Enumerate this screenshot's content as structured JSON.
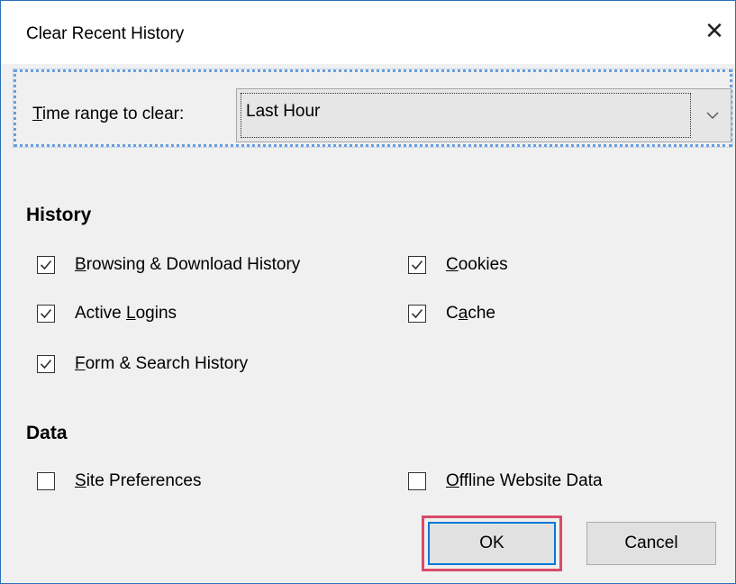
{
  "dialog": {
    "title": "Clear Recent History",
    "close_icon": "close-icon"
  },
  "time_range": {
    "label_prefix": "T",
    "label_rest": "ime range to clear:",
    "selected": "Last Hour"
  },
  "history": {
    "heading": "History",
    "items": [
      {
        "pre": "",
        "key": "B",
        "post": "rowsing & Download History",
        "checked": true
      },
      {
        "pre": "",
        "key": "C",
        "post": "ookies",
        "checked": true
      },
      {
        "pre": "Active ",
        "key": "L",
        "post": "ogins",
        "checked": true
      },
      {
        "pre": "C",
        "key": "a",
        "post": "che",
        "checked": true
      },
      {
        "pre": "",
        "key": "F",
        "post": "orm & Search History",
        "checked": true
      }
    ]
  },
  "data_section": {
    "heading": "Data",
    "items": [
      {
        "pre": "",
        "key": "S",
        "post": "ite Preferences",
        "checked": false
      },
      {
        "pre": "",
        "key": "O",
        "post": "ffline Website Data",
        "checked": false
      }
    ]
  },
  "buttons": {
    "ok": "OK",
    "cancel": "Cancel"
  }
}
